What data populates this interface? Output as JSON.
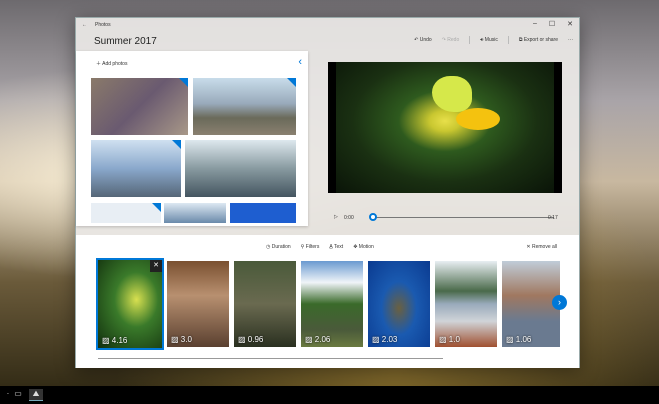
{
  "window": {
    "app_name": "Photos",
    "title": "Summer 2017"
  },
  "commands": {
    "undo": "Undo",
    "redo": "Redo",
    "music": "Music",
    "export": "Export or share",
    "more": "···"
  },
  "library": {
    "add_photos": "Add photos"
  },
  "player": {
    "current_time": "0:00",
    "total_time": "0:17",
    "progress": 0
  },
  "toolbar": {
    "duration": "Duration",
    "filters": "Filters",
    "text": "Text",
    "motion": "Motion",
    "remove_all": "Remove all"
  },
  "storyboard": [
    {
      "duration": "4.16",
      "selected": true
    },
    {
      "duration": "3.0"
    },
    {
      "duration": "0.96"
    },
    {
      "duration": "2.06"
    },
    {
      "duration": "2.03"
    },
    {
      "duration": "1.0"
    },
    {
      "duration": "1.06"
    }
  ],
  "colors": {
    "accent": "#0078d7"
  }
}
